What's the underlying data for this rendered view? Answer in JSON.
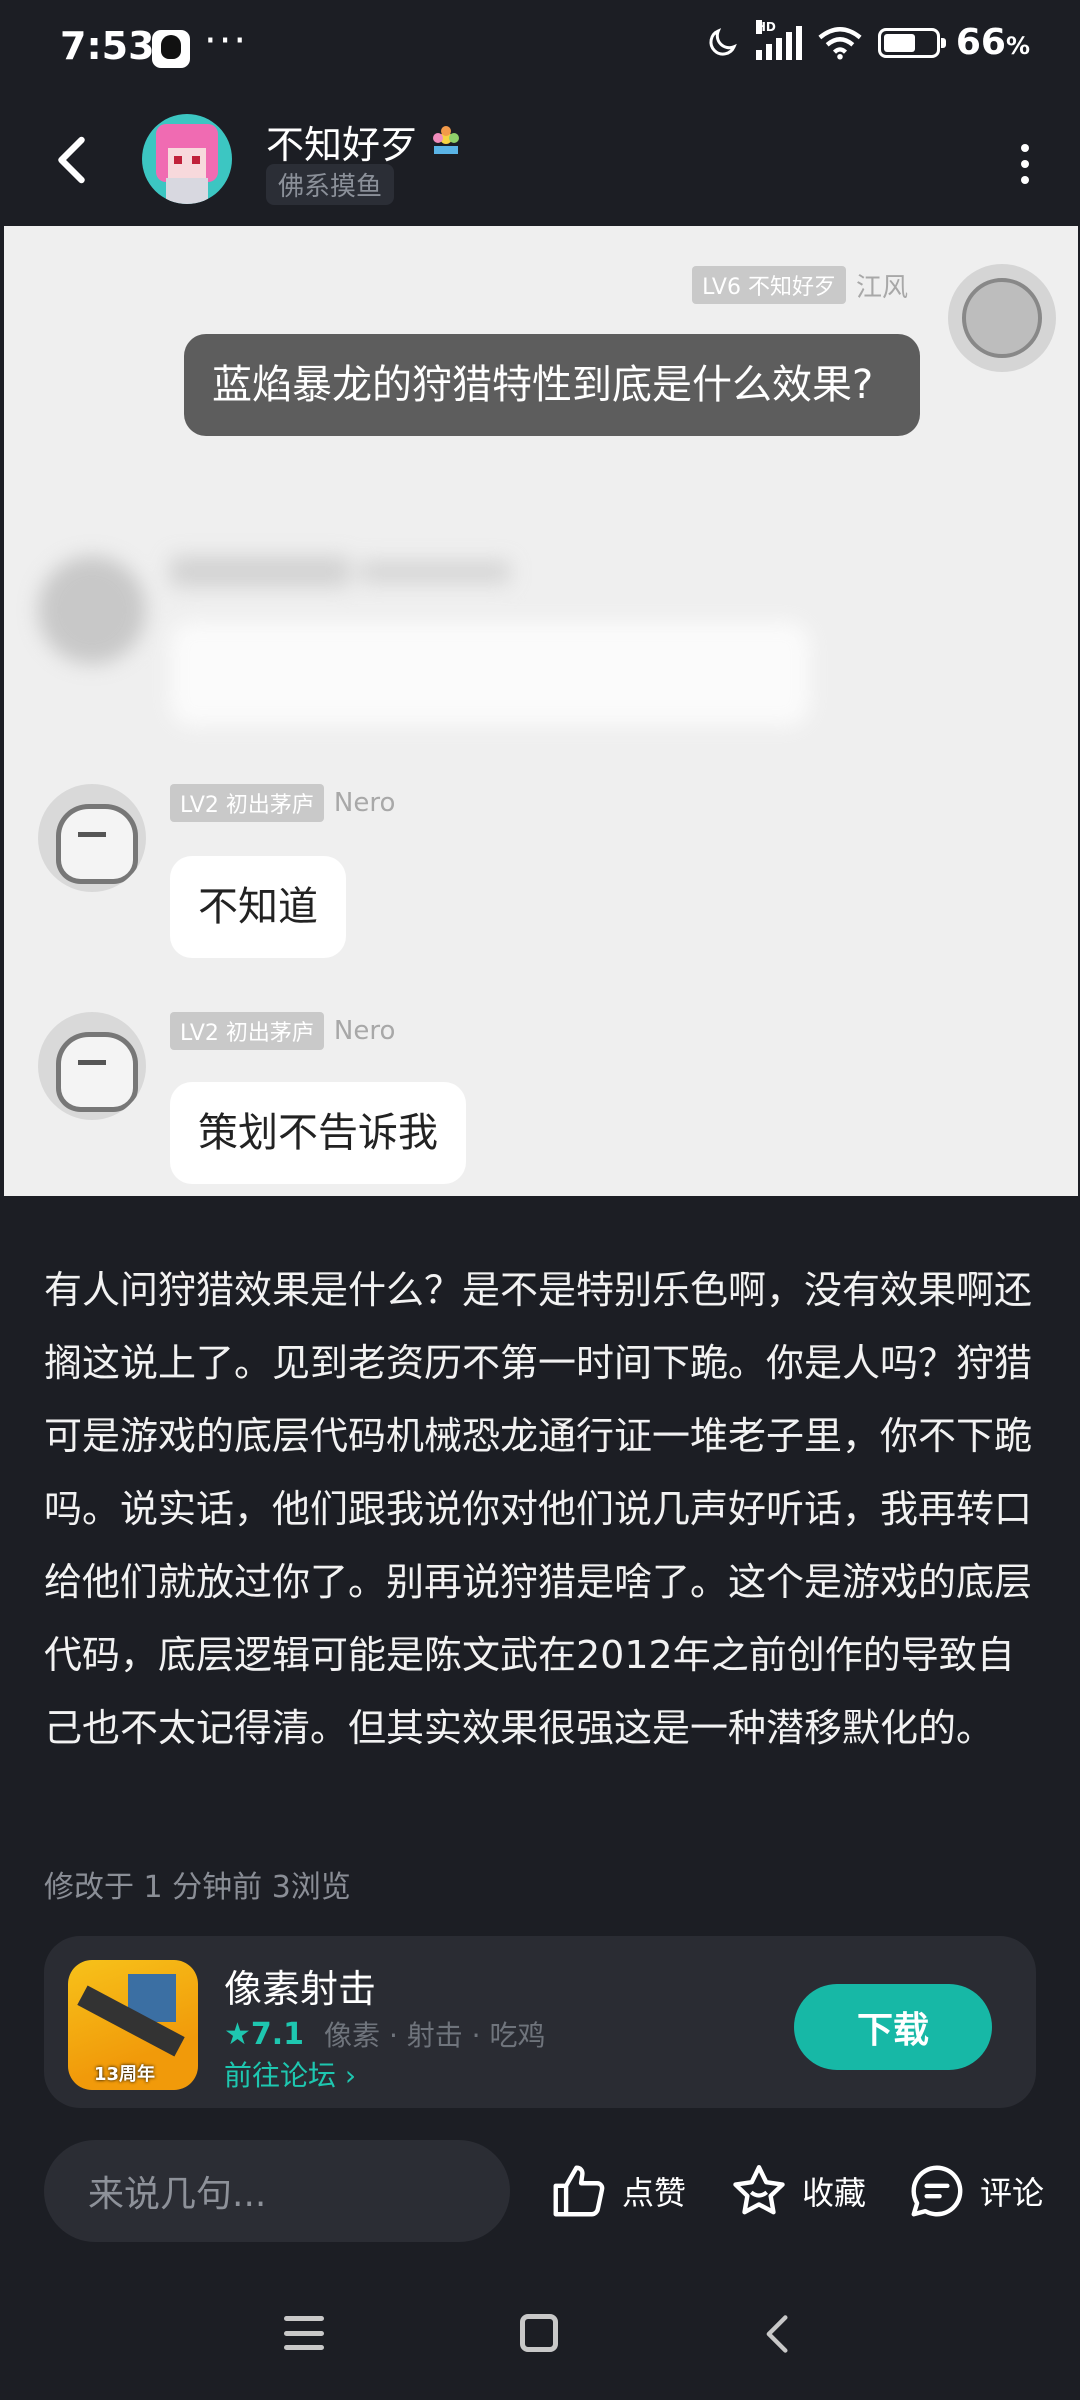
{
  "status_bar": {
    "time": "7:53",
    "dots": "···",
    "hd_label": "HD",
    "battery_text": "66",
    "battery_unit": "%",
    "battery_level": 0.66,
    "icons": [
      "qq-icon",
      "moon-icon",
      "signal-icon",
      "wifi-icon",
      "battery-icon"
    ]
  },
  "header": {
    "username": "不知好歹",
    "user_tag": "佛系摸鱼"
  },
  "post_image": {
    "messages": [
      {
        "side": "right",
        "level": "LV6 不知好歹",
        "name": "江风",
        "text": "蓝焰暴龙的狩猎特性到底是什么效果?"
      },
      {
        "side": "left",
        "level": "",
        "name": "",
        "text": "",
        "blurred": true
      },
      {
        "side": "left",
        "level": "LV2 初出茅庐",
        "name": "Nero",
        "text": "不知道"
      },
      {
        "side": "left",
        "level": "LV2 初出茅庐",
        "name": "Nero",
        "text": "策划不告诉我"
      }
    ]
  },
  "post": {
    "body": "有人问狩猎效果是什么？是不是特别乐色啊，没有效果啊还搁这说上了。见到老资历不第一时间下跪。你是人吗？狩猎可是游戏的底层代码机械恐龙通行证一堆老子里，你不下跪吗。说实话，他们跟我说你对他们说几声好听话，我再转口给他们就放过你了。别再说狩猎是啥了。这个是游戏的底层代码，底层逻辑可能是陈文武在2012年之前创作的导致自己也不太记得清。但其实效果很强这是一种潜移默化的。",
    "meta": "修改于 1 分钟前  3浏览"
  },
  "game_card": {
    "name": "像素射击",
    "rating": "★7.1",
    "tags": "像素 · 射击 · 吃鸡",
    "forum_link": "前往论坛 ›",
    "icon_label": "13周年",
    "download_label": "下载",
    "accent_color": "#17b8a6"
  },
  "action_bar": {
    "comment_placeholder": "来说几句...",
    "like_label": "点赞",
    "favorite_label": "收藏",
    "comment_label": "评论"
  }
}
